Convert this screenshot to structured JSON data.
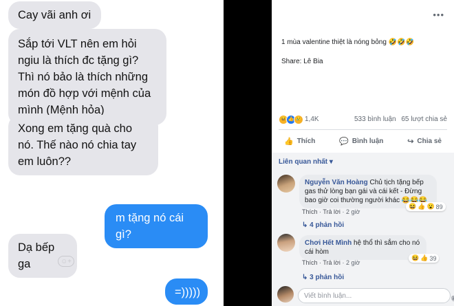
{
  "chat": {
    "messages": [
      {
        "side": "in",
        "text": "Cay vãi  anh ơi"
      },
      {
        "side": "in",
        "text": "Sắp tới VLT nên em hỏi ngiu là thích đc tặng gì? Thì nó bảo là thích những món đồ hợp với mệnh của mình (Mệnh hỏa)"
      },
      {
        "side": "in",
        "text": "Xong em tặng quà cho nó. Thế  nào nó chia tay em luôn??"
      },
      {
        "side": "out",
        "text": "m tặng nó cái gì?"
      },
      {
        "side": "in",
        "text": "Dạ bếp ga"
      },
      {
        "side": "out",
        "text": "=)))))"
      }
    ],
    "add_reaction_icon": "add-reaction-icon"
  },
  "post": {
    "menu_icon": "more-dots-icon",
    "text": "1 mùa valentine thiệt là nóng bỏng 🤣🤣🤣",
    "share": "Share: Lê Bia",
    "reaction_count": "1,4K",
    "comments_count": "533 bình luận",
    "shares_count": "65 lượt chia sẻ",
    "actions": {
      "like": "Thích",
      "comment": "Bình luận",
      "share": "Chia sẻ"
    },
    "sort_label": "Liên quan nhất ▾",
    "comments": [
      {
        "name": "Nguyễn Văn Hoàng",
        "text": "Chủ tịch tặng bếp gas thử lòng bạn gái và cái kết - Đừng bao giờ coi thường người khác 😂😂😂",
        "like": "Thích",
        "reply": "Trả lời",
        "time": "2 giờ",
        "reaction_count": "89",
        "replies": "4 phản hồi"
      },
      {
        "name": "Chơi Hết Mình",
        "text": "hệ thổ thì sắm cho nó cái hòm",
        "like": "Thích",
        "reply": "Trả lời",
        "time": "2 giờ",
        "reaction_count": "39",
        "replies": "3 phản hồi"
      }
    ],
    "write_placeholder": "Viết bình luận..."
  },
  "colors": {
    "outgoing": "#2a8cf5",
    "incoming": "#e5e5ea",
    "fb_link": "#385898"
  }
}
